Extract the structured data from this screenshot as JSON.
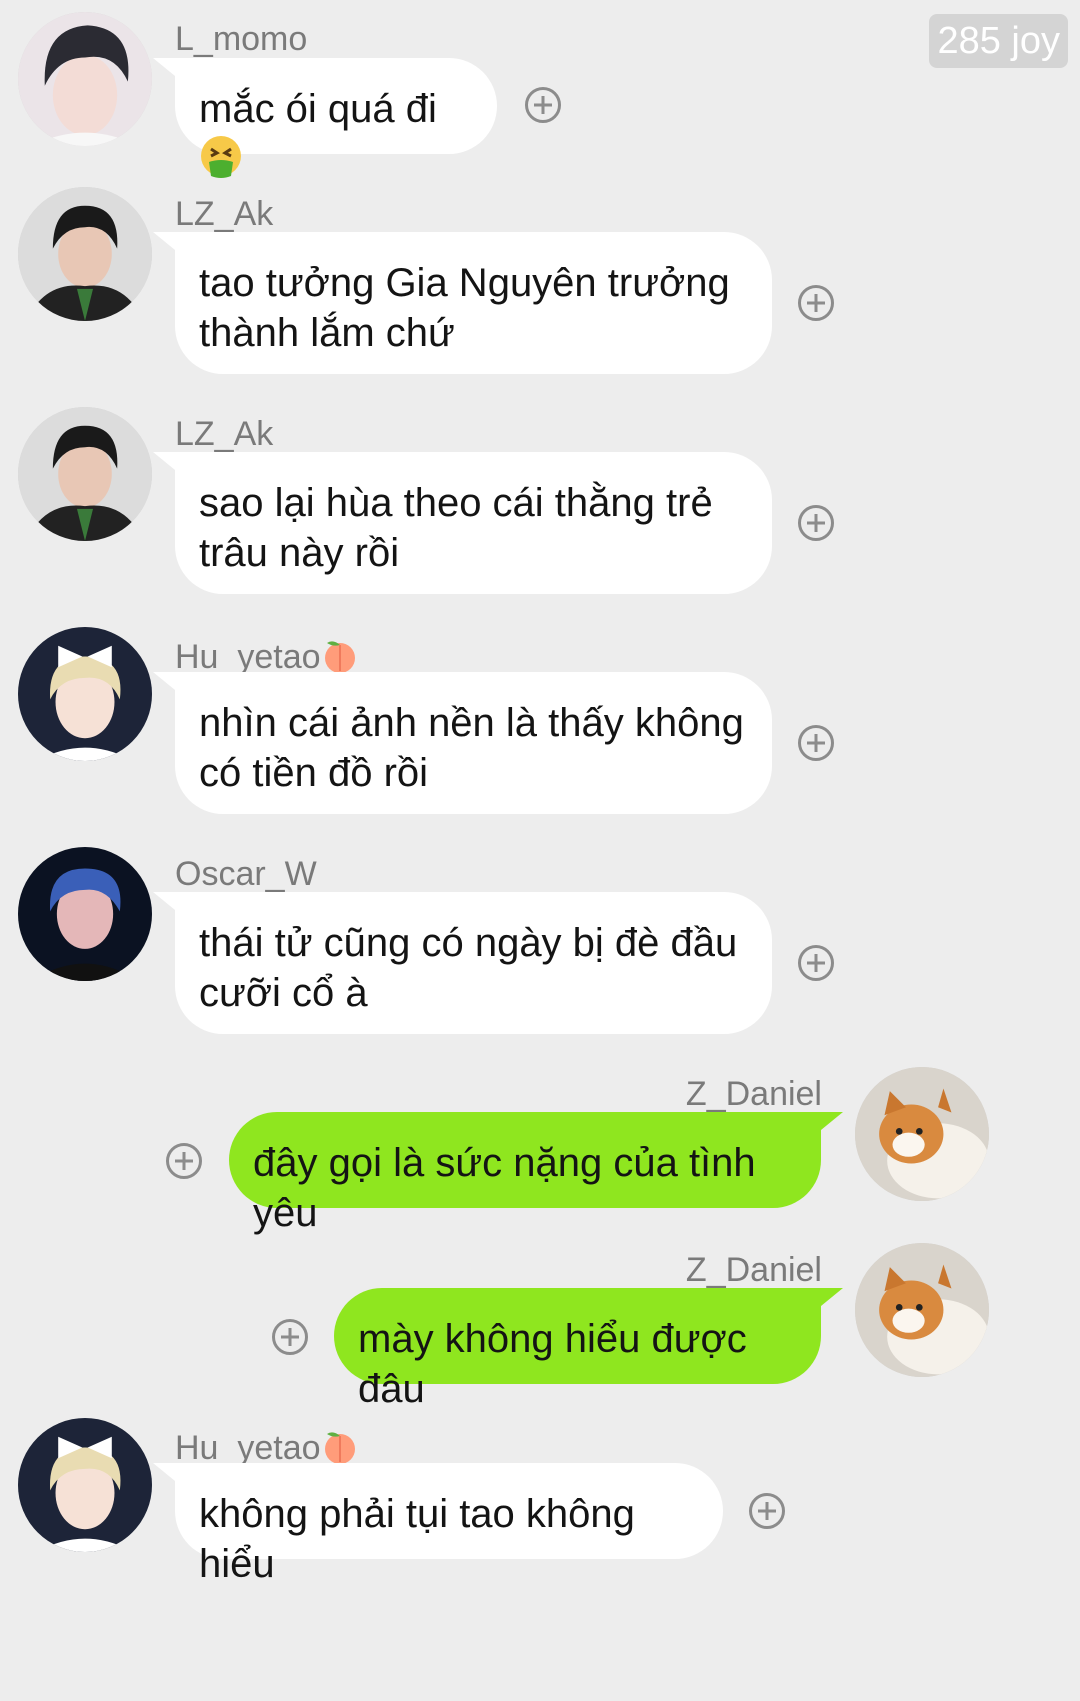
{
  "watermark": "285 joy",
  "messages": [
    {
      "sender": "L_momo",
      "text": "mắc ói quá đi",
      "emoji": "vomiting-face",
      "direction": "in",
      "avatar": "avatar-girl-dark-hair"
    },
    {
      "sender": "LZ_Ak",
      "text": "tao tưởng Gia Nguyên trưởng thành lắm chứ",
      "direction": "in",
      "avatar": "avatar-man-black-jacket"
    },
    {
      "sender": "LZ_Ak",
      "text": "sao lại hùa theo cái thằng trẻ trâu này rồi",
      "direction": "in",
      "avatar": "avatar-man-black-jacket"
    },
    {
      "sender": "Hu_yetao",
      "sender_emoji": "peach",
      "text": "nhìn cái ảnh nền là thấy không có tiền đồ rồi",
      "direction": "in",
      "avatar": "avatar-blond-bow"
    },
    {
      "sender": "Oscar_W",
      "text": "thái tử cũng có ngày bị đè đầu cưỡi cổ à",
      "direction": "in",
      "avatar": "avatar-blue-light"
    },
    {
      "sender": "Z_Daniel",
      "text": "đây gọi là sức nặng của tình yêu",
      "direction": "out",
      "avatar": "avatar-cat"
    },
    {
      "sender": "Z_Daniel",
      "text": "mày không hiểu được đâu",
      "direction": "out",
      "avatar": "avatar-cat"
    },
    {
      "sender": "Hu_yetao",
      "sender_emoji": "peach",
      "text": "không phải tụi tao không hiểu",
      "direction": "in",
      "avatar": "avatar-blond-bow"
    }
  ],
  "colors": {
    "background": "#ededed",
    "incoming_bubble": "#ffffff",
    "outgoing_bubble": "#8fe61f",
    "sender_name": "#7a7a7a",
    "message_text": "#141414",
    "plus_icon": "#8c8c8c"
  }
}
